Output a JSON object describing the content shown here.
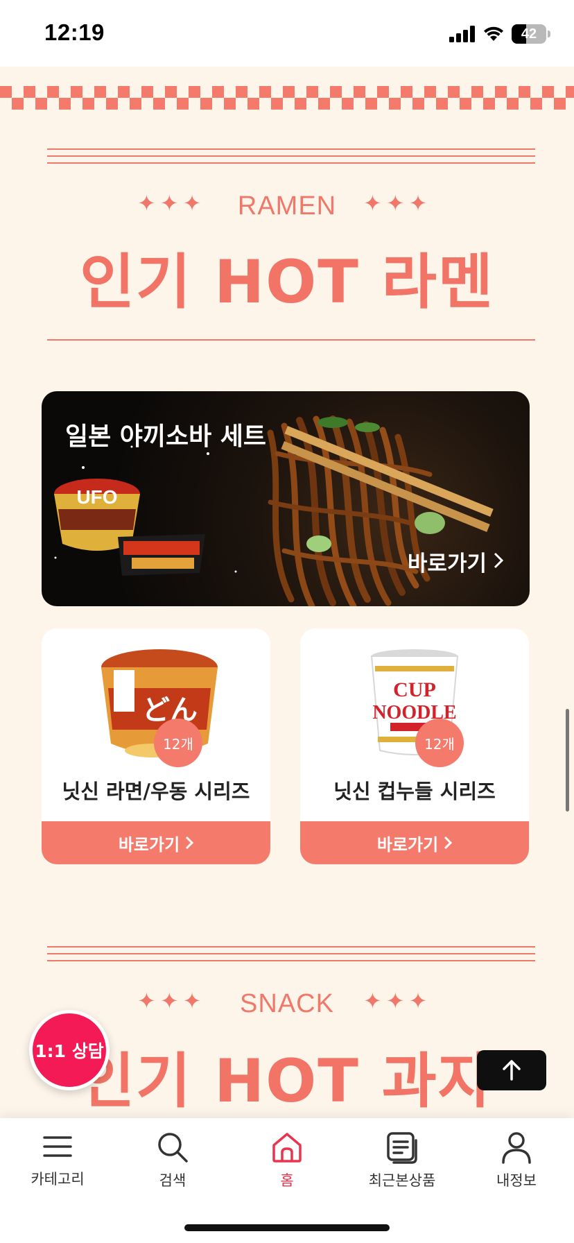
{
  "status_bar": {
    "time": "12:19",
    "battery": "42"
  },
  "ramen_section": {
    "eyebrow": "RAMEN",
    "stars_left": "✦✦✦",
    "stars_right": "✦✦✦",
    "title": "인기 HOT 라멘"
  },
  "banner": {
    "title": "일본 야끼소바 세트",
    "link_label": "바로가기"
  },
  "cards": [
    {
      "title": "닛신 라면/우동 시리즈",
      "count": "12개",
      "button": "바로가기"
    },
    {
      "title": "닛신 컵누들 시리즈",
      "count": "12개",
      "button": "바로가기"
    }
  ],
  "snack_section": {
    "eyebrow": "SNACK",
    "stars_left": "✦✦✦",
    "stars_right": "✦✦✦",
    "title": "인기 HOT 과자"
  },
  "floating": {
    "chat_label": "1:1 상담"
  },
  "bottom_nav": {
    "items": [
      {
        "label": "카테고리",
        "icon": "menu-icon"
      },
      {
        "label": "검색",
        "icon": "search-icon"
      },
      {
        "label": "홈",
        "icon": "home-icon"
      },
      {
        "label": "최근본상품",
        "icon": "recent-products-icon"
      },
      {
        "label": "내정보",
        "icon": "user-icon"
      }
    ],
    "active_color": "#e8344e"
  },
  "colors": {
    "accent": "#f47a6c",
    "background": "#fdf5ea"
  }
}
